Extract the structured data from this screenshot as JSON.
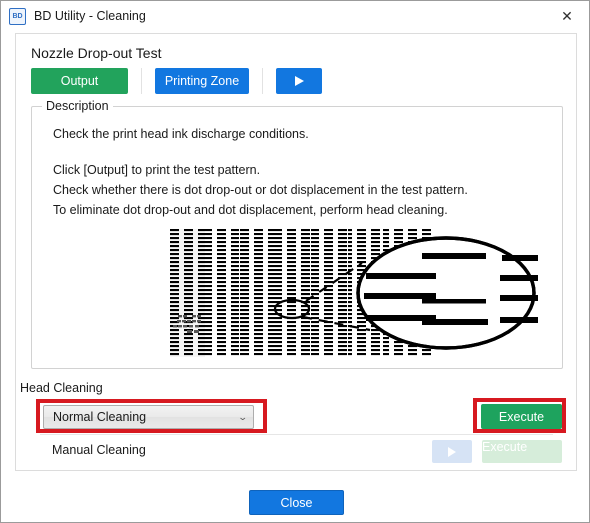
{
  "window": {
    "title": "BD Utility - Cleaning",
    "app_icon": "BD",
    "close_icon": "✕"
  },
  "content": {
    "section_title": "Nozzle Drop-out Test",
    "toolbar": {
      "output_label": "Output",
      "printing_zone_label": "Printing Zone",
      "play_icon": "play-triangle"
    },
    "description": {
      "legend": "Description",
      "line1": "Check the print head ink discharge conditions.",
      "line2": "Click [Output] to print the test pattern.",
      "line3": "Check whether there is dot drop-out or dot displacement in the test pattern.",
      "line4": "To eliminate dot drop-out and dot displacement, perform head cleaning."
    },
    "head_cleaning": {
      "label": "Head Cleaning",
      "mode_value": "Normal Cleaning",
      "mode_arrow": "⌄",
      "execute_label": "Execute",
      "manual_label": "Manual Cleaning",
      "manual_play_icon": "play-triangle",
      "manual_execute_label": "Execute"
    }
  },
  "footer": {
    "close_label": "Close"
  },
  "colors": {
    "green_button": "#22a35c",
    "blue_button": "#1277e0",
    "annotation_red": "#d71920",
    "disabled_green": "#d6edda",
    "disabled_blue": "#d6e3f5"
  },
  "pattern": {
    "band_colors": [
      "#ececec",
      "#fdf7a8",
      "#f9b6d4",
      "#8c8c8c",
      "#a9e2f7"
    ],
    "callout": "magnifier-ellipse"
  }
}
